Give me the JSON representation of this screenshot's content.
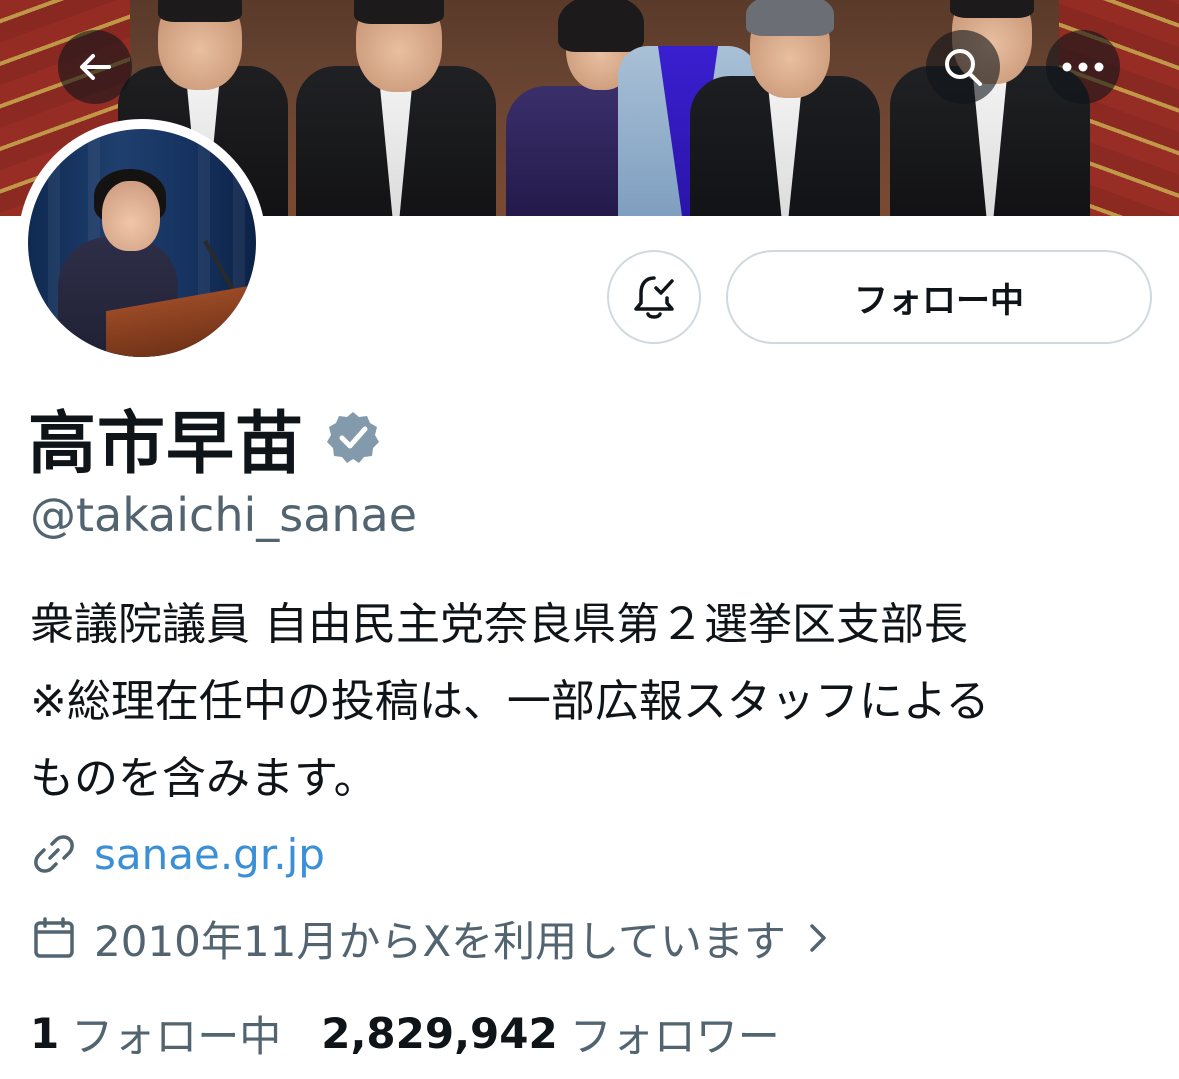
{
  "header": {
    "back_icon": "arrow-left-icon",
    "search_icon": "search-icon",
    "more_icon": "more-horizontal-icon"
  },
  "profile": {
    "display_name": "高市早苗",
    "verified_badge": "verified-badge-icon",
    "verified_color": "#829aab",
    "handle": "@takaichi_sanae",
    "bio_lines": [
      "衆議院議員 自由民主党奈良県第２選挙区支部長",
      "※総理在任中の投稿は、一部広報スタッフによる",
      "ものを含みます。"
    ],
    "website": "sanae.gr.jp",
    "joined": "2010年11月からXを利用しています"
  },
  "actions": {
    "notify_icon": "bell-check-icon",
    "follow_label": "フォロー中"
  },
  "stats": {
    "following_count": "1",
    "following_label": "フォロー中",
    "followers_count": "2,829,942",
    "followers_label": "フォロワー"
  },
  "colors": {
    "text_primary": "#0f1419",
    "text_secondary": "#536471",
    "link": "#3b8fd6",
    "border": "#cfd9de"
  }
}
